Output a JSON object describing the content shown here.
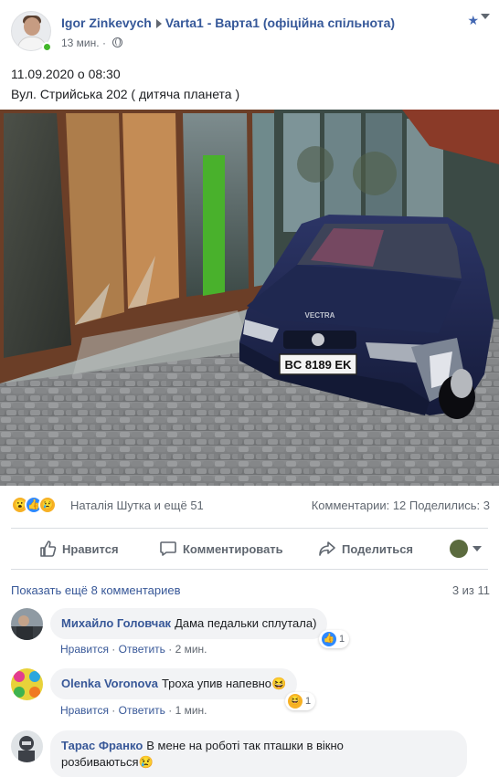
{
  "post": {
    "author": "Igor Zinkevych",
    "group": "Varta1 - Варта1 (офіційна спільнота)",
    "time": "13 мин.",
    "separator": "·",
    "text_line1": "11.09.2020 о 08:30",
    "text_line2": "Вул. Стрийська 202 ( дитяча планета )",
    "photo_plate": "BC 8189 EK",
    "photo_hood_text": "VECTRA"
  },
  "reactions": {
    "names": "Наталія Шутка и ещё 51",
    "stats": "Комментарии: 12   Поделились: 3",
    "icons": [
      "wow-icon",
      "like-icon",
      "sad-icon"
    ]
  },
  "actions": {
    "like": "Нравится",
    "comment": "Комментировать",
    "share": "Поделиться"
  },
  "comments_section": {
    "more": "Показать ещё 8 комментариев",
    "count": "3 из 11"
  },
  "comments": [
    {
      "name": "Михайло Головчак",
      "text": "Дама педальки сплутала)",
      "like": "Нравится",
      "reply": "Ответить",
      "time": "2 мин.",
      "reaction_count": "1",
      "reaction_icon": "like-icon"
    },
    {
      "name": "Olenka Voronova",
      "text": "Троха упив напевно😆",
      "like": "Нравится",
      "reply": "Ответить",
      "time": "1 мин.",
      "reaction_count": "1",
      "reaction_icon": "haha-icon"
    },
    {
      "name": "Тарас Франко",
      "text_line1": "В мене на роботі так пташки в вікно",
      "text_line2": "розбиваються😢"
    }
  ],
  "colors": {
    "link": "#385898",
    "author": "#365899",
    "secondary": "#606770",
    "bubble": "#f2f3f5",
    "online": "#42b72a",
    "like_blue": "#2e89ff"
  }
}
